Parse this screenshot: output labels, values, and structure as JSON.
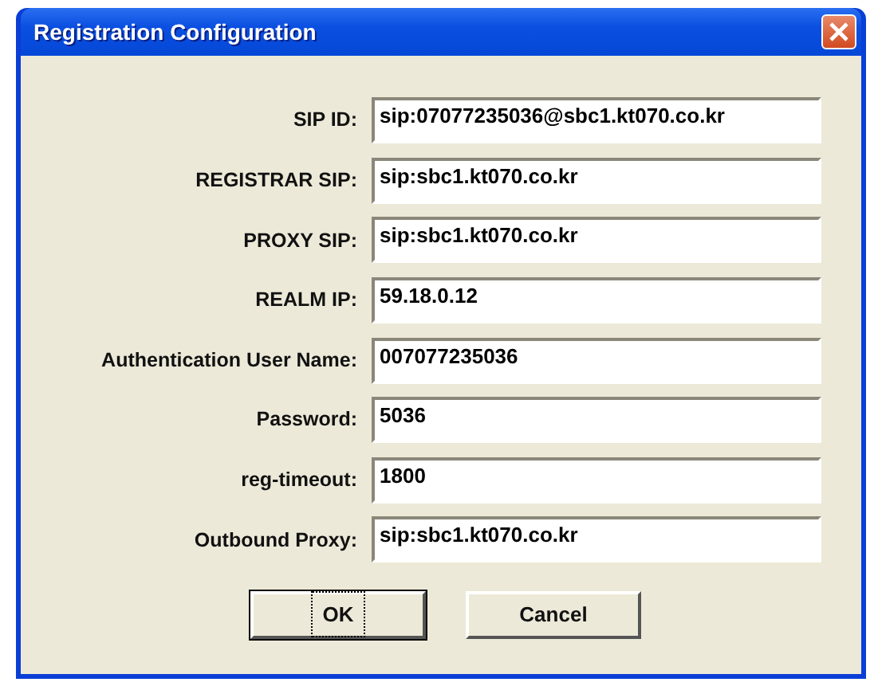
{
  "window": {
    "title": "Registration Configuration"
  },
  "fields": [
    {
      "label": "SIP ID:",
      "value": "sip:07077235036@sbc1.kt070.co.kr"
    },
    {
      "label": "REGISTRAR SIP:",
      "value": "sip:sbc1.kt070.co.kr"
    },
    {
      "label": "PROXY SIP:",
      "value": "sip:sbc1.kt070.co.kr"
    },
    {
      "label": "REALM IP:",
      "value": "59.18.0.12"
    },
    {
      "label": "Authentication User Name:",
      "value": "007077235036"
    },
    {
      "label": "Password:",
      "value": "5036"
    },
    {
      "label": "reg-timeout:",
      "value": "1800"
    },
    {
      "label": "Outbound Proxy:",
      "value": "sip:sbc1.kt070.co.kr"
    }
  ],
  "buttons": [
    {
      "label": "OK",
      "focused": true
    },
    {
      "label": "Cancel",
      "focused": false
    }
  ]
}
